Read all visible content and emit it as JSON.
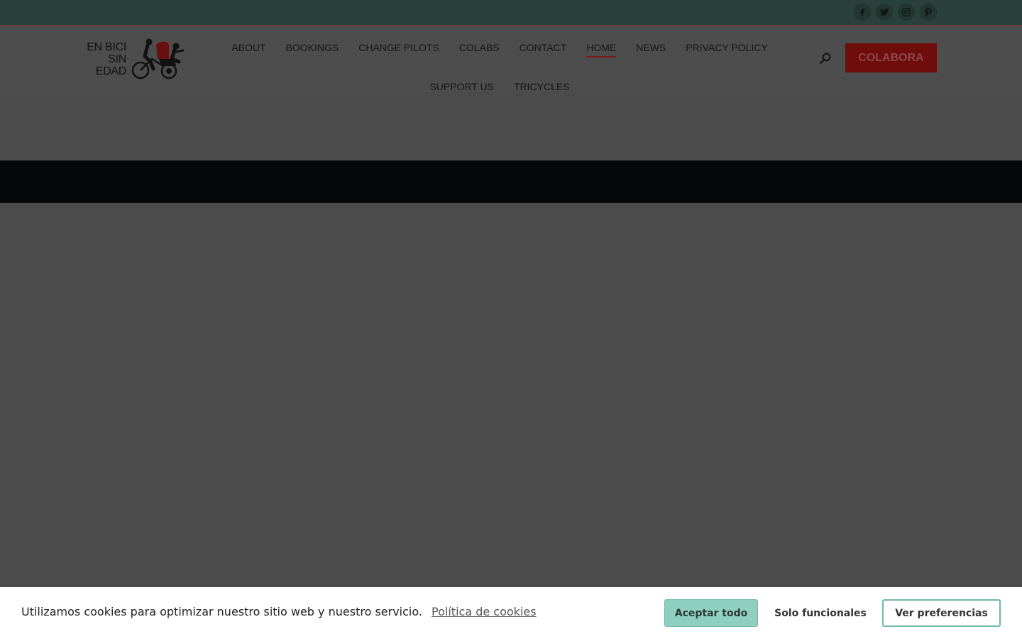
{
  "topbar": {
    "social": [
      {
        "icon": "facebook-icon"
      },
      {
        "icon": "twitter-icon"
      },
      {
        "icon": "instagram-icon"
      },
      {
        "icon": "pinterest-icon"
      }
    ]
  },
  "header": {
    "logo": {
      "line1": "EN BICI",
      "line2": "SIN",
      "line3": "EDAD"
    },
    "nav": [
      {
        "label": "ABOUT"
      },
      {
        "label": "BOOKINGS"
      },
      {
        "label": "CHANGE PILOTS"
      },
      {
        "label": "COLABS"
      },
      {
        "label": "CONTACT"
      },
      {
        "label": "HOME",
        "active": true
      },
      {
        "label": "NEWS"
      },
      {
        "label": "PRIVACY POLICY"
      },
      {
        "label": "SUPPORT US"
      },
      {
        "label": "TRICYCLES"
      }
    ],
    "cta_label": "COLABORA"
  },
  "cookie": {
    "message": "Utilizamos cookies para optimizar nuestro sitio web y nuestro servicio.",
    "policy_link": "Política de cookies",
    "accept_label": "Aceptar todo",
    "functional_label": "Solo funcionales",
    "prefs_label": "Ver preferencias"
  },
  "colors": {
    "topbar": "#2a403b",
    "overlay": "#4b4b4b",
    "accent_red": "#6f0c0c",
    "cookie_accent": "#8fcfc0"
  }
}
